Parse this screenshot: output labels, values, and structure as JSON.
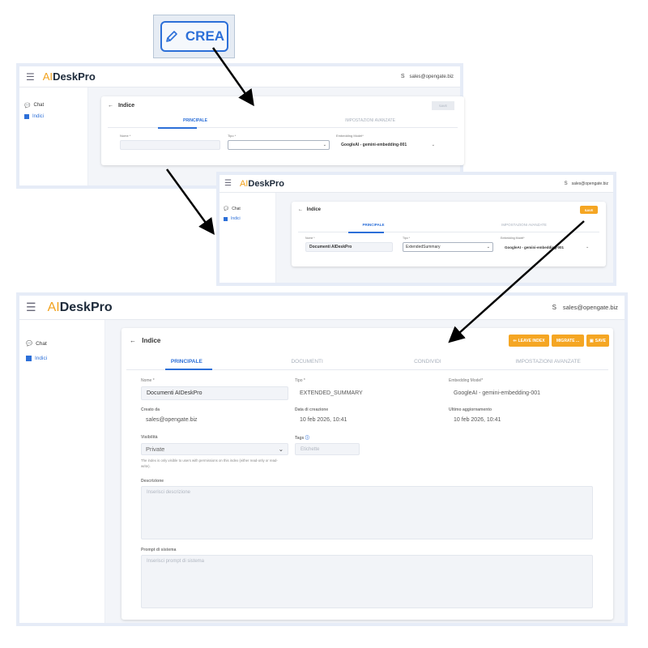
{
  "crea_button": {
    "label": "CREA",
    "icon": "pencil-icon"
  },
  "app": {
    "logo_ai": "AI",
    "logo_text": "DeskPro",
    "user_initial": "S",
    "user_email": "sales@opengate.biz"
  },
  "sidebar": {
    "items": [
      {
        "label": "Chat",
        "icon": "chat-icon"
      },
      {
        "label": "Indici",
        "icon": "index-icon"
      }
    ]
  },
  "screen1": {
    "title": "Indice",
    "save_label": "SAVE",
    "tabs": [
      "PRINCIPALE",
      "IMPOSTAZIONI AVANZATE"
    ],
    "nome_label": "Nome *",
    "nome_value": "",
    "tipo_label": "Tipo *",
    "tipo_value": "",
    "embedding_label": "Embedding Model*",
    "embedding_value": "GoogleAI - gemini-embedding-001"
  },
  "screen2": {
    "title": "Indice",
    "save_label": "SAVE",
    "tabs": [
      "PRINCIPALE",
      "IMPOSTAZIONI AVANZATE"
    ],
    "nome_label": "Nome *",
    "nome_value": "Documenti AIDeskPro",
    "tipo_label": "Tipo *",
    "tipo_value": "ExtendedSummary",
    "embedding_label": "Embedding Model*",
    "embedding_value": "GoogleAI - gemini-embedding-001"
  },
  "screen3": {
    "title": "Indice",
    "buttons": {
      "leave": "LEAVE INDEX",
      "migrate": "MIGRATE ...",
      "save": "SAVE"
    },
    "tabs": [
      "PRINCIPALE",
      "DOCUMENTI",
      "CONDIVIDI",
      "IMPOSTAZIONI AVANZATE"
    ],
    "nome_label": "Nome *",
    "nome_value": "Documenti AIDeskPro",
    "tipo_label": "Tipo *",
    "tipo_value": "EXTENDED_SUMMARY",
    "embedding_label": "Embedding Model*",
    "embedding_value": "GoogleAI - gemini-embedding-001",
    "creato_label": "Creato da",
    "creato_value": "sales@opengate.biz",
    "data_label": "Data di creazione",
    "data_value": "10 feb 2026, 10:41",
    "ultimo_label": "Ultimo aggiornamento",
    "ultimo_value": "10 feb 2026, 10:41",
    "visibilita_label": "Visibilità",
    "visibilita_value": "Private",
    "visibilita_help": "The index is only visible to users with permissions on this index (either read-only or read-write).",
    "tags_label": "Tags",
    "tags_placeholder": "Etichette",
    "descrizione_label": "Descrizione",
    "descrizione_placeholder": "Inserisci descrizione",
    "prompt_label": "Prompt di sistema",
    "prompt_placeholder": "Inserisci prompt di sistema"
  },
  "colors": {
    "accent": "#2c6fd8",
    "orange": "#f5a623",
    "orange_dark": "#e5962a"
  }
}
